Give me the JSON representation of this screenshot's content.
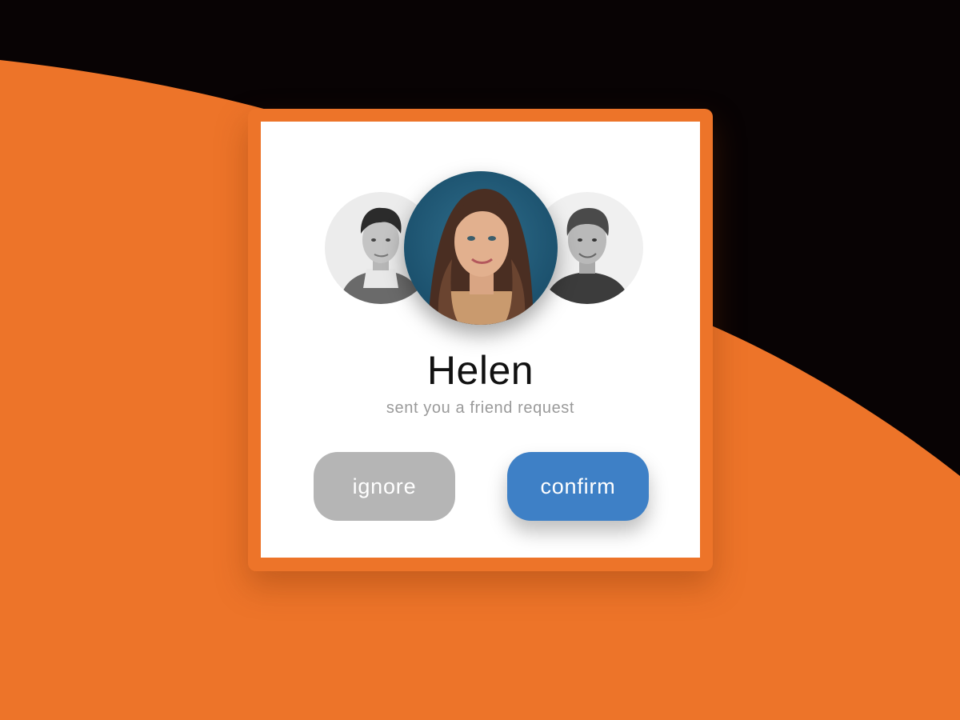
{
  "colors": {
    "background_orange": "#ed7429",
    "background_dark": "#080304",
    "card": "#ffffff",
    "confirm_button": "#3e80c6",
    "ignore_button": "#b5b5b5",
    "name_text": "#111111",
    "subtitle_text": "#9a9a9a"
  },
  "request": {
    "name": "Helen",
    "message": "sent you a friend request"
  },
  "avatars": [
    {
      "position": "left",
      "description": "grayscale-man-photo"
    },
    {
      "position": "center",
      "description": "woman-photo-blue-background"
    },
    {
      "position": "right",
      "description": "grayscale-man-photo"
    }
  ],
  "actions": {
    "ignore_label": "ignore",
    "confirm_label": "confirm"
  }
}
